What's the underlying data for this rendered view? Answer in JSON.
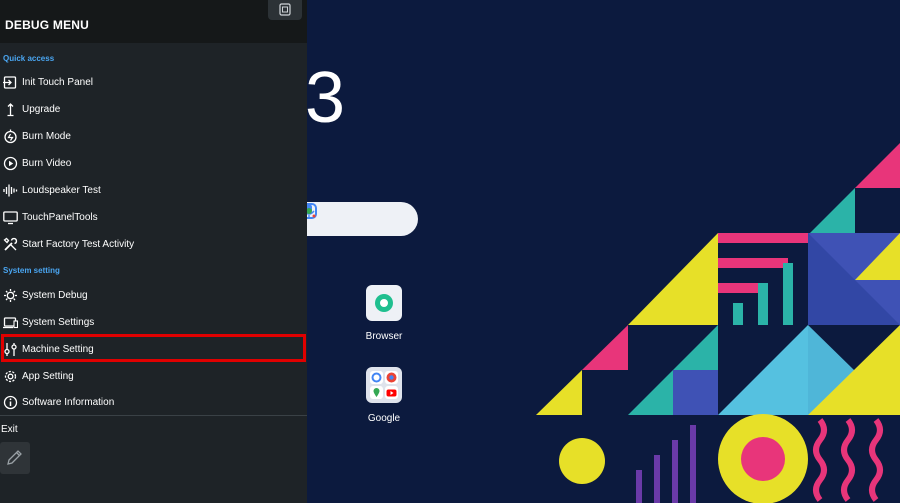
{
  "menu": {
    "title": "DEBUG MENU",
    "quick_access": {
      "heading": "Quick access",
      "items": [
        {
          "label": "Init Touch Panel",
          "icon": "login-arrow-icon"
        },
        {
          "label": "Upgrade",
          "icon": "upgrade-arrow-icon"
        },
        {
          "label": "Burn Mode",
          "icon": "burn-mode-icon"
        },
        {
          "label": "Burn Video",
          "icon": "play-circle-icon"
        },
        {
          "label": "Loudspeaker Test",
          "icon": "waveform-icon"
        },
        {
          "label": "TouchPanelTools",
          "icon": "monitor-icon"
        },
        {
          "label": "Start Factory Test Activity",
          "icon": "tools-icon"
        }
      ]
    },
    "system_setting": {
      "heading": "System setting",
      "items": [
        {
          "label": "System Debug",
          "icon": "bug-gear-icon"
        },
        {
          "label": "System Settings",
          "icon": "devices-icon"
        },
        {
          "label": "Machine Setting",
          "icon": "tune-icon",
          "highlighted": true
        },
        {
          "label": "App Setting",
          "icon": "gear-icon"
        },
        {
          "label": "Software Information",
          "icon": "info-icon"
        }
      ]
    },
    "exit_label": "Exit"
  },
  "home": {
    "clock_fragment": "3",
    "apps": [
      {
        "label": "Browser",
        "icon": "browser-icon"
      },
      {
        "label": "Google",
        "icon": "google-folder-icon"
      }
    ]
  },
  "colors": {
    "panel_bg": "#1e2327",
    "section_heading": "#4aa6f2",
    "highlight_border": "#e00000",
    "wallpaper_bg": "#0c1a3e"
  }
}
